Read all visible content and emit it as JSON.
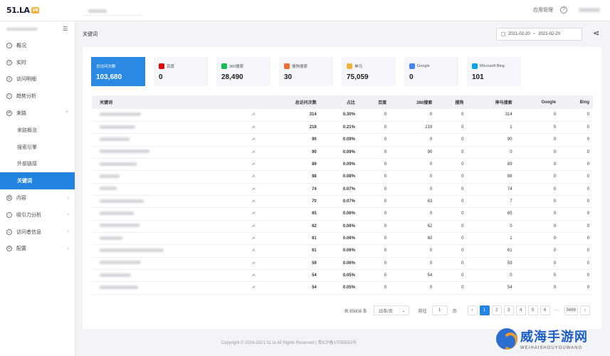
{
  "app": {
    "logo": "51.LA",
    "logo_badge": "V6"
  },
  "topbar": {
    "app_manage": "应用管理"
  },
  "sidebar": {
    "items": [
      {
        "label": "概况",
        "icon": "gauge-icon",
        "type": "top"
      },
      {
        "label": "实时",
        "icon": "clock-icon",
        "type": "top"
      },
      {
        "label": "访问明细",
        "icon": "list-icon",
        "type": "top"
      },
      {
        "label": "趋势分析",
        "icon": "chart-icon",
        "type": "top"
      },
      {
        "label": "来路",
        "icon": "source-icon",
        "type": "top",
        "expanded": true
      },
      {
        "label": "来路概览",
        "type": "sub"
      },
      {
        "label": "搜索引擎",
        "type": "sub"
      },
      {
        "label": "外部链接",
        "type": "sub"
      },
      {
        "label": "关键词",
        "type": "sub",
        "active": true
      },
      {
        "label": "内容",
        "icon": "file-icon",
        "type": "top",
        "arrow": true
      },
      {
        "label": "吸引力分析",
        "icon": "magnet-icon",
        "type": "top",
        "arrow": true
      },
      {
        "label": "访问者信息",
        "icon": "user-icon",
        "type": "top",
        "arrow": true
      },
      {
        "label": "配置",
        "icon": "gear-icon",
        "type": "top",
        "arrow": true
      }
    ]
  },
  "header": {
    "breadcrumb": "关键词",
    "date_from": "2021-02-20",
    "date_sep": "~",
    "date_to": "2021-02-20"
  },
  "cards": [
    {
      "label": "总访问次数",
      "value": "103,680",
      "active": true,
      "logo_color": ""
    },
    {
      "label": "百度",
      "value": "0",
      "logo_color": "#e10602"
    },
    {
      "label": "360搜索",
      "value": "28,490",
      "logo_color": "#19b955"
    },
    {
      "label": "搜狗搜索",
      "value": "30",
      "logo_color": "#f26a2e"
    },
    {
      "label": "神马",
      "value": "75,059",
      "logo_color": "#f3b33a"
    },
    {
      "label": "Google",
      "value": "0",
      "logo_color": "#4285f4"
    },
    {
      "label": "Microsoft Bing",
      "value": "101",
      "logo_color": "#00a4ef"
    }
  ],
  "table": {
    "headers": [
      "关键词",
      "总访问次数",
      "占比",
      "百度",
      "360搜索",
      "搜狗",
      "神马搜索",
      "Google",
      "Bing"
    ],
    "rows": [
      [
        "314",
        "0.30%",
        "0",
        "0",
        "0",
        "314",
        "0",
        "0"
      ],
      [
        "219",
        "0.21%",
        "0",
        "219",
        "0",
        "1",
        "0",
        "0"
      ],
      [
        "90",
        "0.09%",
        "0",
        "0",
        "0",
        "90",
        "0",
        "0"
      ],
      [
        "90",
        "0.09%",
        "0",
        "90",
        "0",
        "0",
        "0",
        "0"
      ],
      [
        "89",
        "0.09%",
        "0",
        "0",
        "0",
        "89",
        "0",
        "0"
      ],
      [
        "88",
        "0.08%",
        "0",
        "0",
        "0",
        "88",
        "0",
        "0"
      ],
      [
        "74",
        "0.07%",
        "0",
        "0",
        "0",
        "74",
        "0",
        "0"
      ],
      [
        "70",
        "0.07%",
        "0",
        "63",
        "0",
        "7",
        "0",
        "0"
      ],
      [
        "65",
        "0.06%",
        "0",
        "0",
        "0",
        "65",
        "0",
        "0"
      ],
      [
        "62",
        "0.06%",
        "0",
        "62",
        "0",
        "0",
        "0",
        "0"
      ],
      [
        "61",
        "0.06%",
        "0",
        "60",
        "0",
        "1",
        "0",
        "0"
      ],
      [
        "61",
        "0.06%",
        "0",
        "0",
        "0",
        "61",
        "0",
        "0"
      ],
      [
        "59",
        "0.06%",
        "0",
        "0",
        "0",
        "59",
        "0",
        "0"
      ],
      [
        "54",
        "0.05%",
        "0",
        "54",
        "0",
        "0",
        "0",
        "0"
      ],
      [
        "54",
        "0.05%",
        "0",
        "0",
        "0",
        "54",
        "0",
        "0"
      ]
    ]
  },
  "pager": {
    "total": "共 85008 条",
    "page_size": "15条/页",
    "goto_prefix": "前往",
    "goto_value": "1",
    "goto_suffix": "页",
    "pages": [
      "1",
      "2",
      "3",
      "4",
      "5",
      "6",
      "···",
      "5668"
    ],
    "current": "1"
  },
  "footer": {
    "copyright": "Copyright © 2016-2021 51.la All Rights Reserved | 粤ICP备17055553号"
  },
  "watermark": {
    "title": "威海手游网",
    "subtitle": "WEIHAISHOUYOUWANG"
  }
}
